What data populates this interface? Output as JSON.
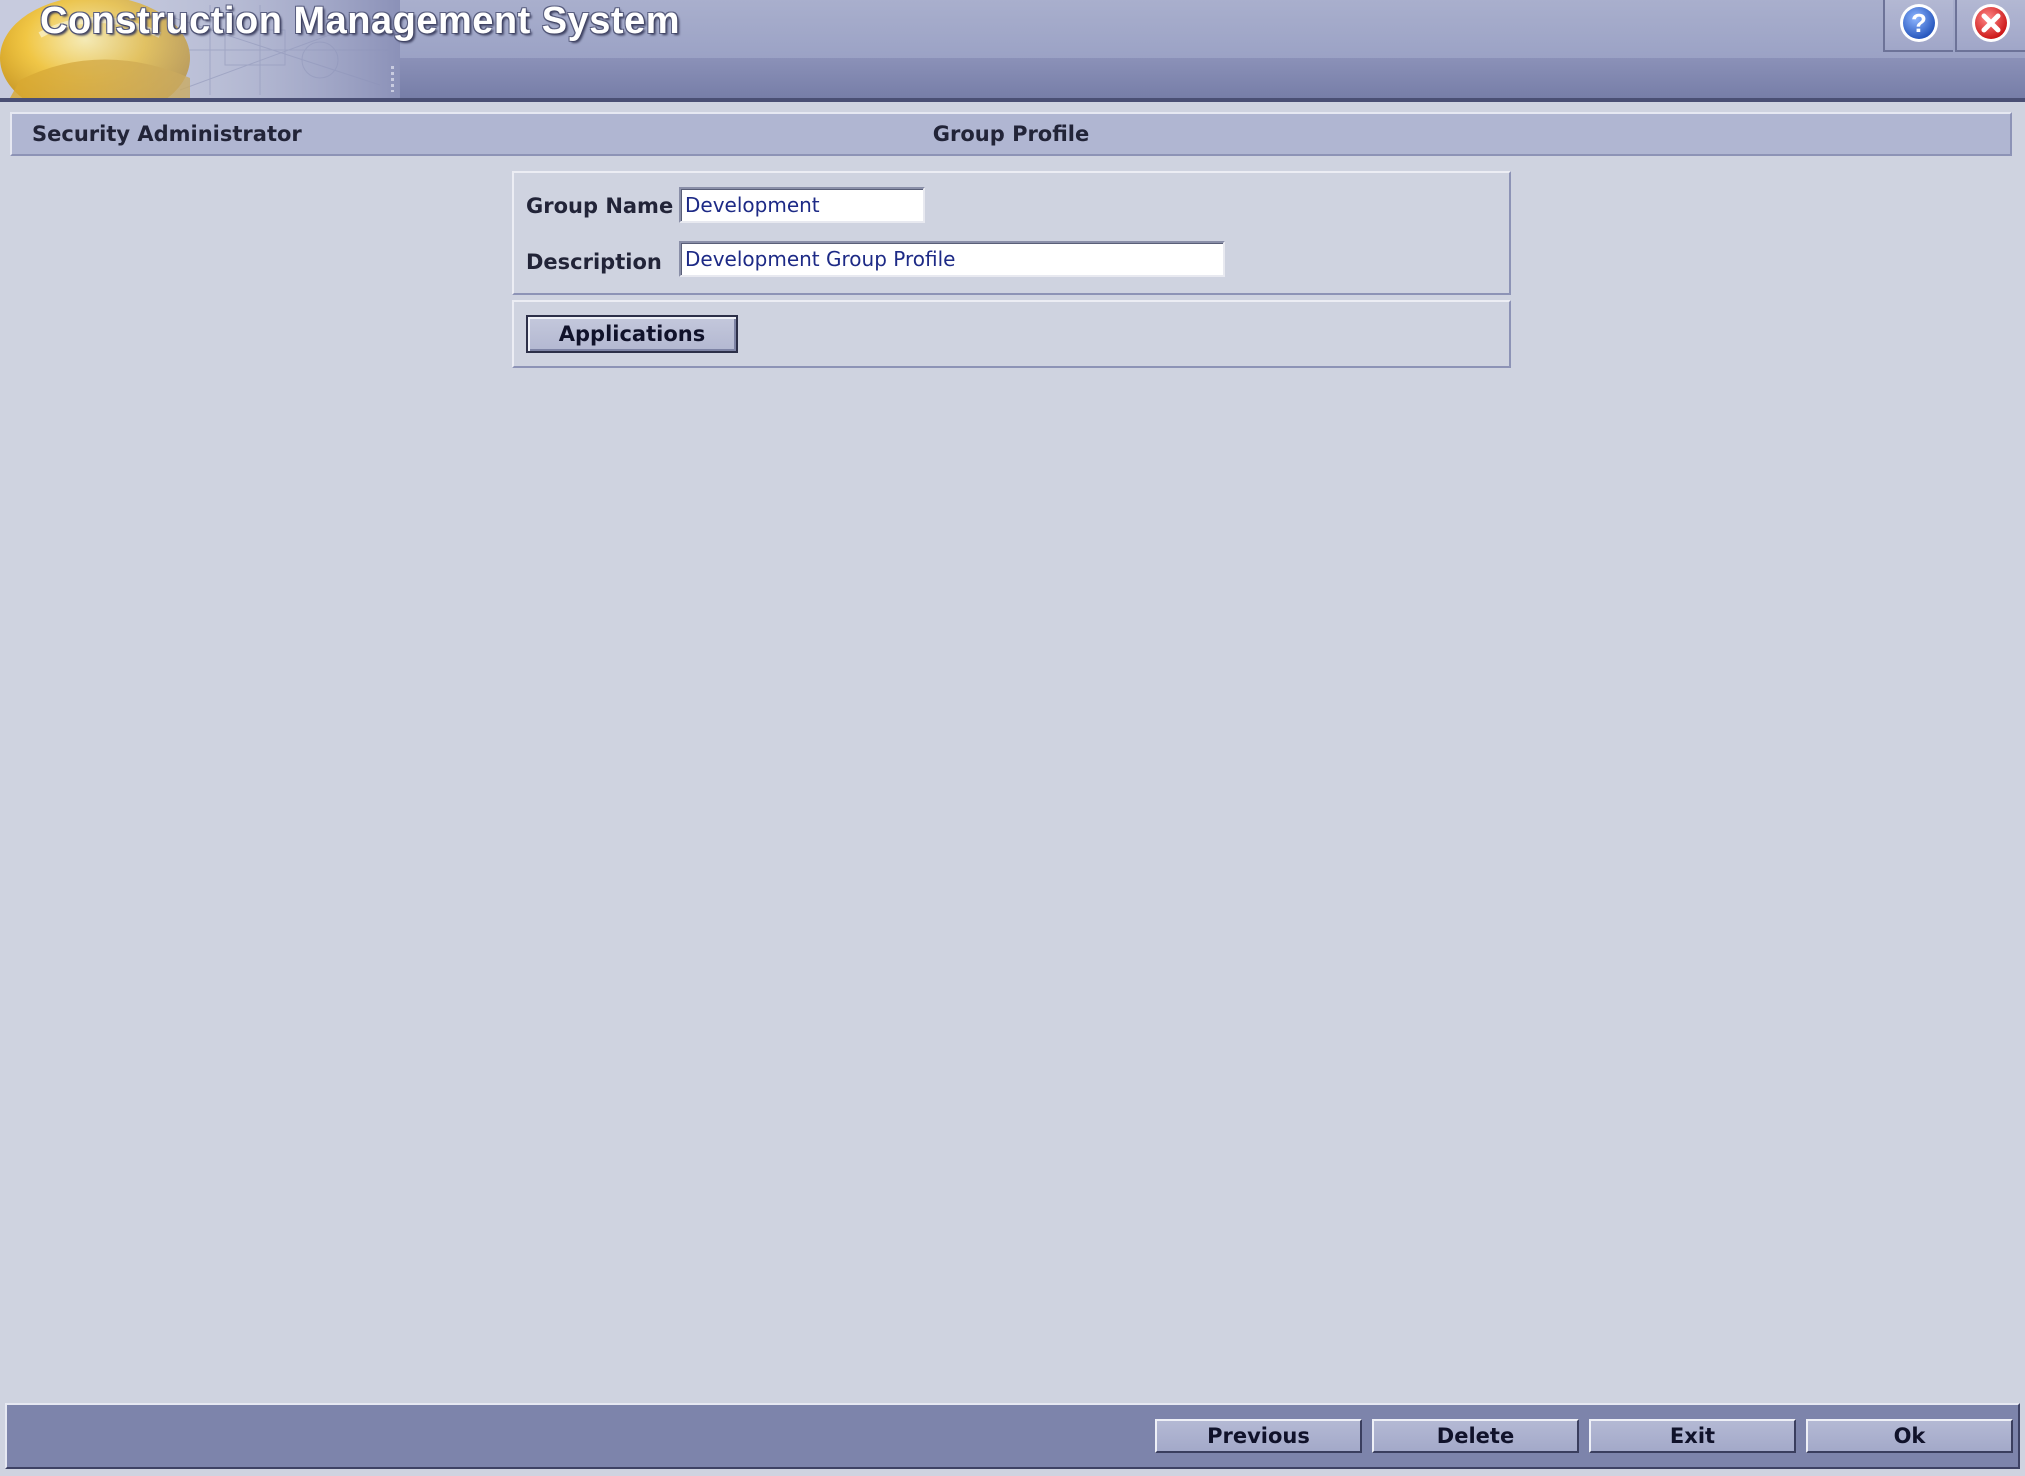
{
  "app": {
    "title": "Construction Management System"
  },
  "title_bar": {
    "help_icon": "help-icon",
    "close_icon": "close-icon"
  },
  "header": {
    "left_label": "Security Administrator",
    "center_title": "Group Profile"
  },
  "form": {
    "group_name": {
      "label": "Group Name",
      "value": "Development"
    },
    "description": {
      "label": "Description",
      "value": "Development Group Profile"
    },
    "applications_label": "Applications"
  },
  "footer": {
    "previous_label": "Previous",
    "delete_label": "Delete",
    "exit_label": "Exit",
    "ok_label": "Ok"
  },
  "colors": {
    "background": "#cfd3e0",
    "title_bar": "#a9afcd",
    "footer_bar": "#7d84ab",
    "input_text": "#1d2a86",
    "close_red": "#d81818",
    "help_blue": "#2e64c8"
  }
}
